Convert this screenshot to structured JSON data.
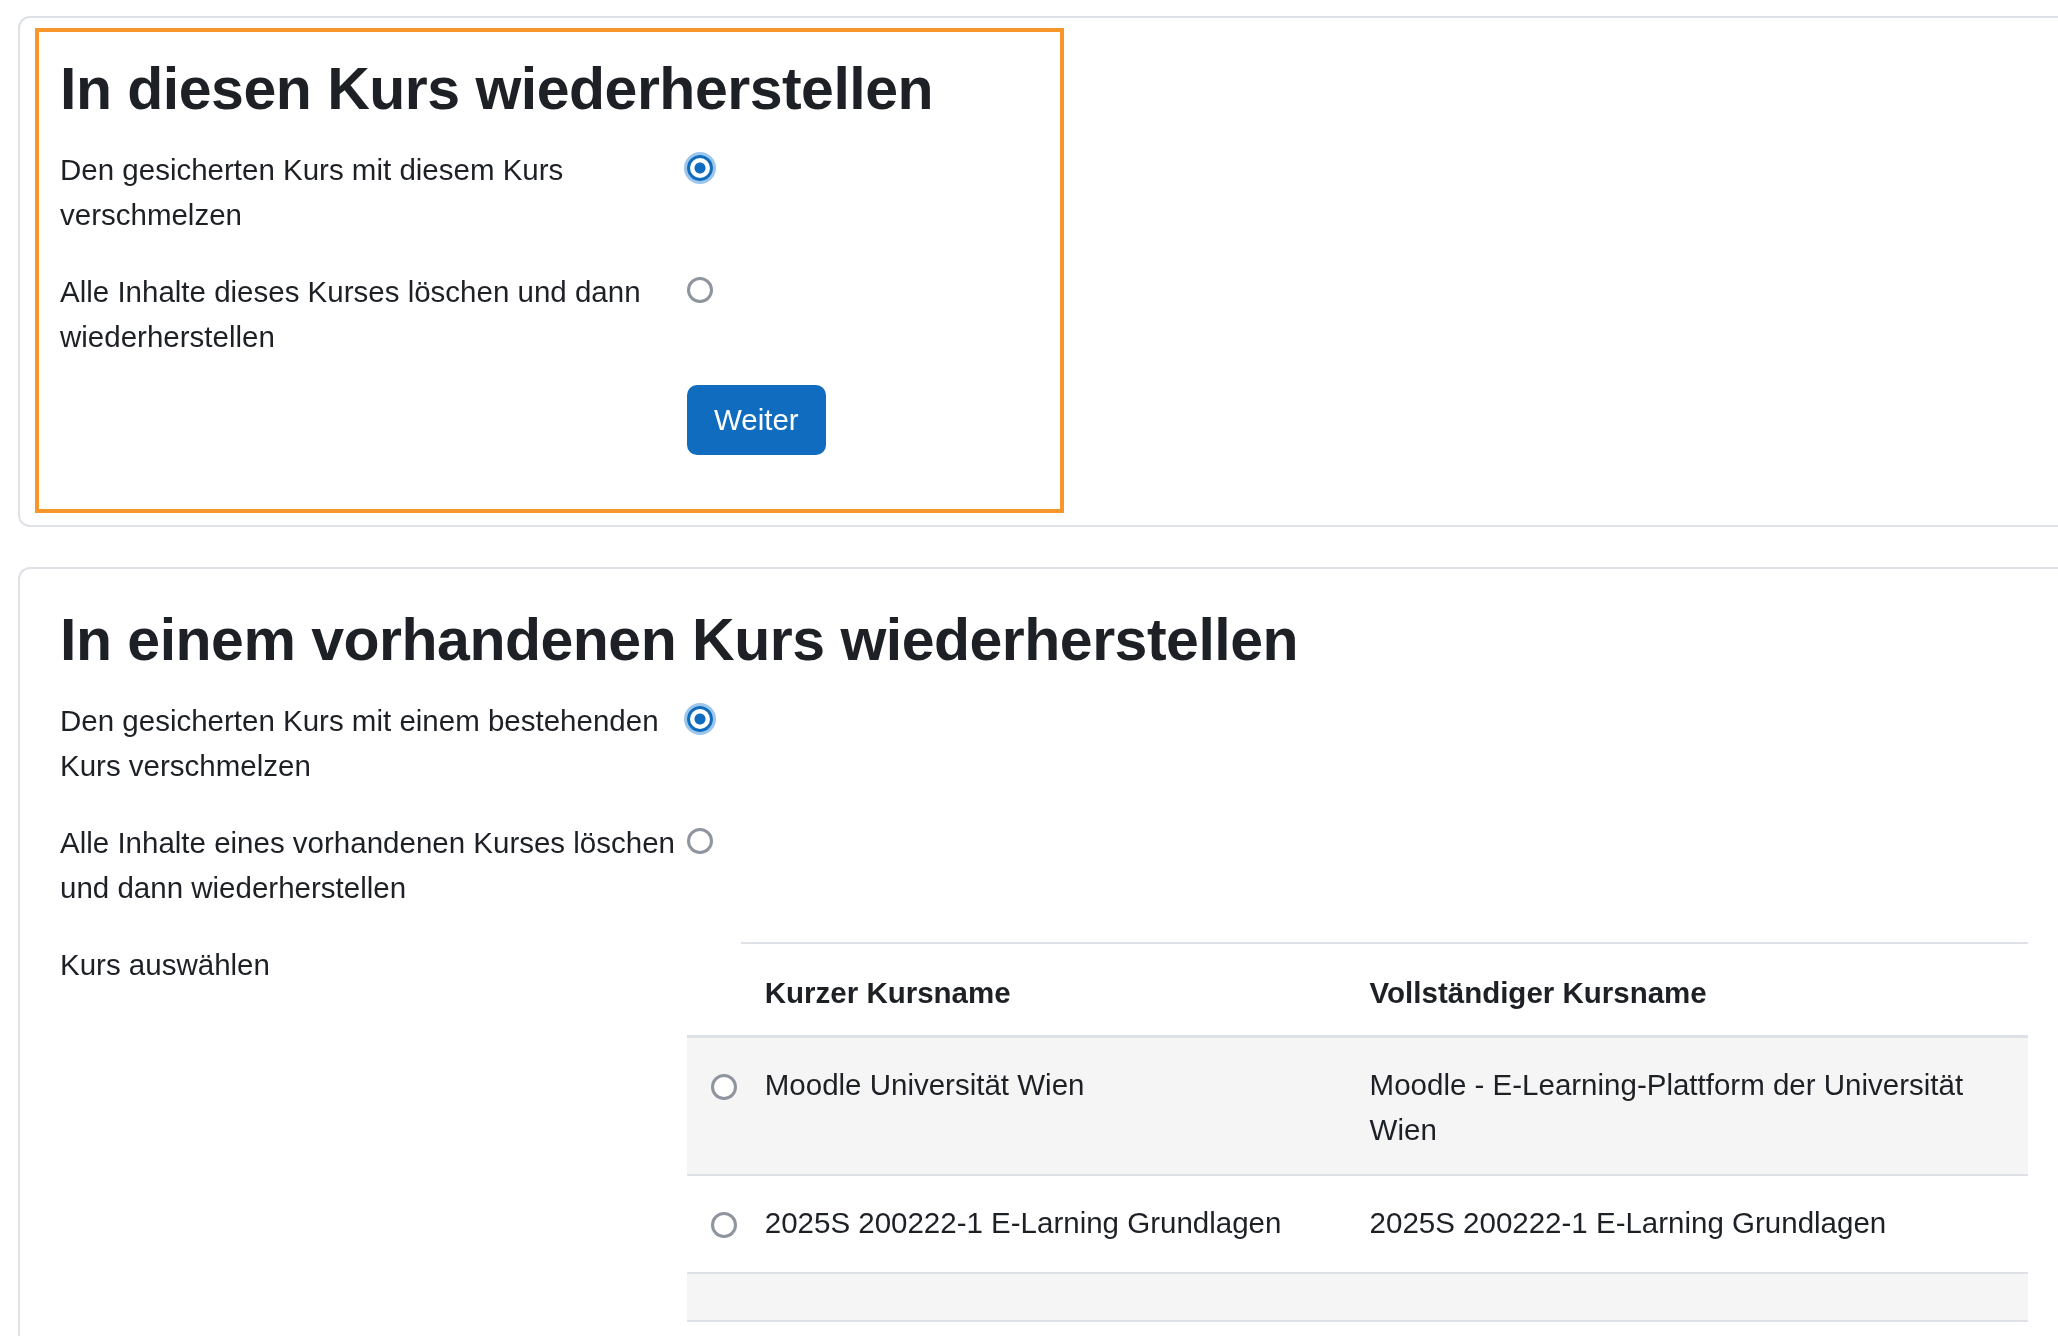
{
  "sections": [
    {
      "title": "In diesen Kurs wiederherstellen",
      "highlighted": true,
      "options": [
        {
          "label": "Den gesicherten Kurs mit diesem Kurs verschmelzen",
          "selected": true
        },
        {
          "label": "Alle Inhalte dieses Kurses löschen und dann wiederherstellen",
          "selected": false
        }
      ],
      "button": "Weiter"
    },
    {
      "title": "In einem vorhandenen Kurs wiederherstellen",
      "highlighted": false,
      "options": [
        {
          "label": "Den gesicherten Kurs mit einem bestehenden Kurs verschmelzen",
          "selected": true
        },
        {
          "label": "Alle Inhalte eines vorhandenen Kurses löschen und dann wiederherstellen",
          "selected": false
        }
      ],
      "select_label": "Kurs auswählen",
      "table": {
        "columns": [
          "Kurzer Kursname",
          "Vollständiger Kursname"
        ],
        "rows": [
          {
            "short_name": "Moodle Universität Wien",
            "full_name": "Moodle - E-Learning-Plattform der Universität Wien",
            "selected": false
          },
          {
            "short_name": "2025S 200222-1 E-Larning Grundlagen",
            "full_name": "2025S 200222-1 E-Larning Grundlagen",
            "selected": false
          }
        ]
      }
    }
  ]
}
